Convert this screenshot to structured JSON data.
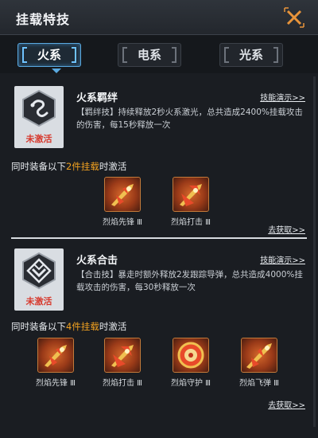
{
  "header": {
    "title": "挂载特技",
    "close_icon": "close-x-icon"
  },
  "tabs": [
    {
      "label": "火系",
      "active": true
    },
    {
      "label": "电系",
      "active": false
    },
    {
      "label": "光系",
      "active": false
    }
  ],
  "skills": [
    {
      "name": "火系羁绊",
      "status": "未激活",
      "demo_label": "技能演示>>",
      "description": "【羁绊技】持续释放2秒火系激光，总共造成2400%挂载攻击的伤害，每15秒释放一次",
      "requirement_prefix": "同时装备以下",
      "requirement_highlight": "2件挂载",
      "requirement_suffix": "时激活",
      "items": [
        {
          "name": "烈焰先锋 Ⅲ"
        },
        {
          "name": "烈焰打击 Ⅲ"
        }
      ],
      "acquire_label": "去获取>>"
    },
    {
      "name": "火系合击",
      "status": "未激活",
      "demo_label": "技能演示>>",
      "description": "【合击技】暴走时额外释放2发跟踪导弹，总共造成4000%挂载攻击的伤害，每30秒释放一次",
      "requirement_prefix": "同时装备以下",
      "requirement_highlight": "4件挂载",
      "requirement_suffix": "时激活",
      "items": [
        {
          "name": "烈焰先锋 Ⅲ"
        },
        {
          "name": "烈焰打击 Ⅲ"
        },
        {
          "name": "烈焰守护 Ⅲ"
        },
        {
          "name": "烈焰飞弹 Ⅲ"
        }
      ],
      "acquire_label": "去获取>>"
    }
  ],
  "colors": {
    "accent": "#5aa9e0",
    "highlight": "#f0a020",
    "inactive": "#d73a2e",
    "background": "#1a1d22"
  }
}
